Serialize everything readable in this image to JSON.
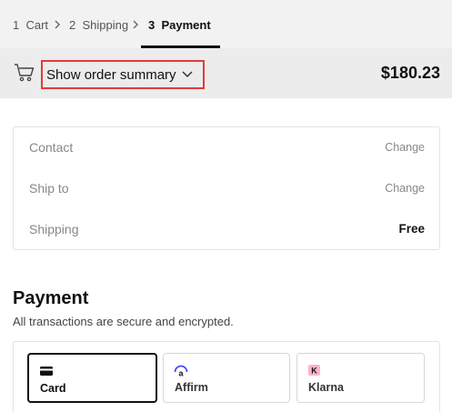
{
  "breadcrumb": {
    "steps": [
      {
        "num": "1",
        "label": "Cart"
      },
      {
        "num": "2",
        "label": "Shipping"
      },
      {
        "num": "3",
        "label": "Payment"
      }
    ]
  },
  "summary_bar": {
    "toggle_label": "Show order summary",
    "total": "$180.23"
  },
  "info": {
    "rows": [
      {
        "label": "Contact",
        "action": "Change"
      },
      {
        "label": "Ship to",
        "action": "Change"
      },
      {
        "label": "Shipping",
        "value": "Free"
      }
    ]
  },
  "payment": {
    "title": "Payment",
    "subtitle": "All transactions are secure and encrypted.",
    "methods": [
      {
        "label": "Card",
        "icon": "card-icon"
      },
      {
        "label": "Affirm",
        "icon": "affirm-icon"
      },
      {
        "label": "Klarna",
        "icon": "klarna-icon",
        "icon_text": "K"
      }
    ]
  },
  "colors": {
    "highlight": "#e23a3a",
    "klarna_pink": "#ffb3c7",
    "affirm_blue": "#4a4af4"
  }
}
